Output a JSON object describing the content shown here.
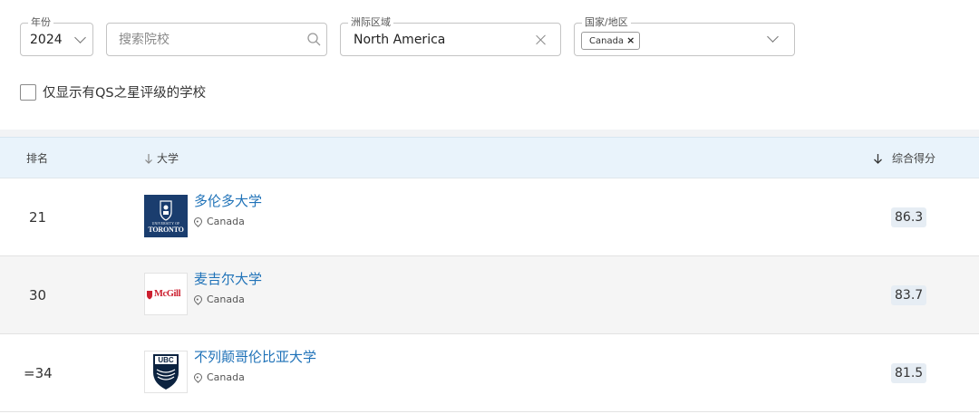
{
  "filters": {
    "year": {
      "legend": "年份",
      "value": "2024"
    },
    "search": {
      "placeholder": "搜索院校"
    },
    "region": {
      "legend": "洲际区域",
      "value": "North America"
    },
    "country": {
      "legend": "国家/地区",
      "chip": "Canada",
      "chip_remove": "×"
    }
  },
  "qs_star_checkbox": {
    "label": "仅显示有QS之星评级的学校",
    "checked": false
  },
  "table": {
    "headers": {
      "rank": "排名",
      "university": "大学",
      "score": "综合得分"
    },
    "rows": [
      {
        "rank": "21",
        "name": "多伦多大学",
        "country": "Canada",
        "score": "86.3",
        "logo": {
          "line1": "UNIVERSITY OF",
          "line2": "TORONTO"
        }
      },
      {
        "rank": "30",
        "name": "麦吉尔大学",
        "country": "Canada",
        "score": "83.7",
        "logo": {
          "text": "McGill"
        }
      },
      {
        "rank": "=34",
        "name": "不列颠哥伦比亚大学",
        "country": "Canada",
        "score": "81.5",
        "logo": {
          "text": "UBC"
        }
      }
    ]
  },
  "colors": {
    "link": "#1f72b8",
    "header_bg": "#e9f3fb",
    "alt_row_bg": "#f5f5f5",
    "score_bg": "#e6edf4",
    "toronto_navy": "#1a3d6e",
    "mcgill_red": "#cc1f2f",
    "ubc_navy": "#0c2340"
  }
}
